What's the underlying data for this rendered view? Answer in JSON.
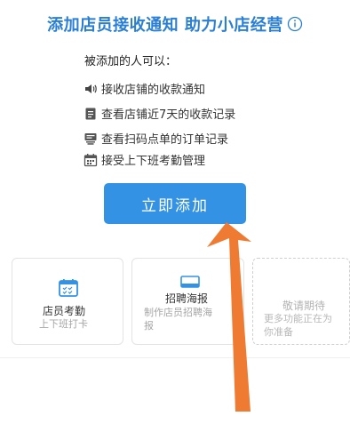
{
  "header": {
    "title": "添加店员接收通知 助力小店经营",
    "info_icon": "info-circle-icon"
  },
  "list": {
    "heading": "被添加的人可以：",
    "items": [
      {
        "icon": "speaker-icon",
        "label": "接收店铺的收款通知"
      },
      {
        "icon": "document-icon",
        "label": "查看店铺近7天的收款记录"
      },
      {
        "icon": "order-icon",
        "label": "查看扫码点单的订单记录"
      },
      {
        "icon": "calendar-icon",
        "label": "接受上下班考勤管理"
      }
    ]
  },
  "button": {
    "label": "立即添加"
  },
  "cards": [
    {
      "icon": "calendar-check-icon",
      "title": "店员考勤",
      "sub": "上下班打卡"
    },
    {
      "icon": "card-icon",
      "title": "招聘海报",
      "sub_lines": [
        "制作店员招聘海",
        "报"
      ]
    },
    {
      "title": "敬请期待",
      "sub_lines": [
        "更多功能正在为",
        "你准备"
      ]
    }
  ],
  "colors": {
    "accent": "#2a7fd4",
    "button": "#3392e4",
    "arrow": "#ef7a32"
  }
}
